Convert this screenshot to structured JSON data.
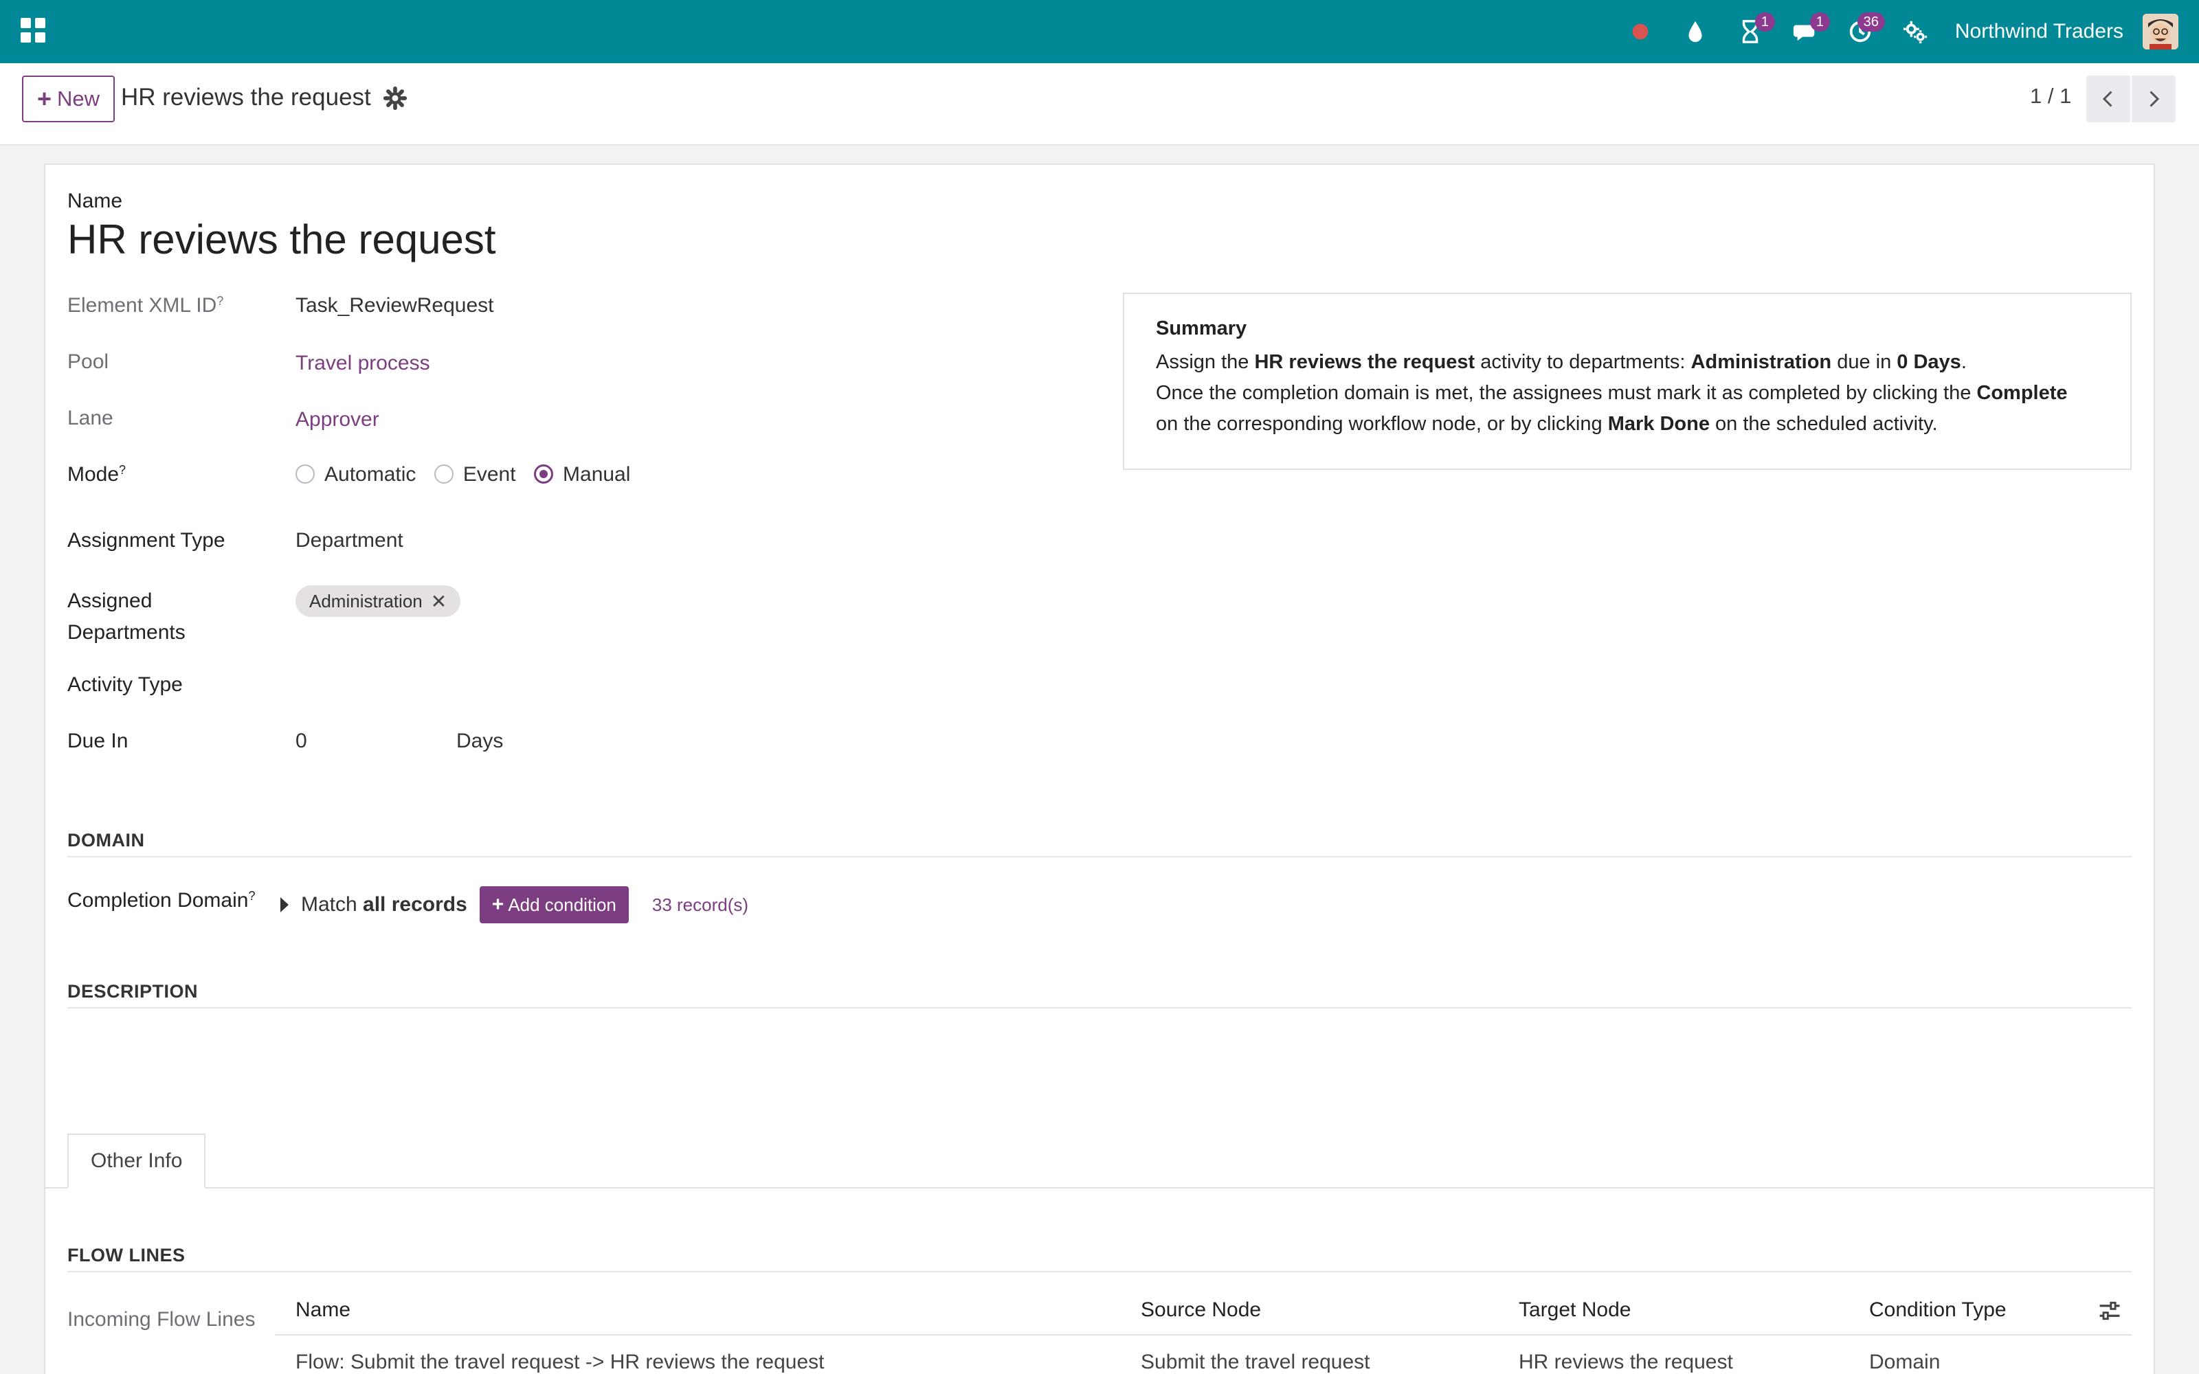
{
  "navbar": {
    "company": "Northwind Traders",
    "badges": {
      "activities": "1",
      "messages": "1",
      "clock": "36"
    },
    "icons": [
      "apps-icon",
      "record-dot-icon",
      "drop-icon",
      "hourglass-icon",
      "chat-icon",
      "clock-icon",
      "settings-icon"
    ]
  },
  "control": {
    "new_label": "New",
    "breadcrumb": "HR reviews the request",
    "pager": "1 / 1"
  },
  "form": {
    "name_label": "Name",
    "name_value": "HR reviews the request",
    "xml_id_label": "Element XML ID",
    "xml_id_value": "Task_ReviewRequest",
    "pool_label": "Pool",
    "pool_value": "Travel process",
    "lane_label": "Lane",
    "lane_value": "Approver",
    "mode_label": "Mode",
    "mode_options": [
      "Automatic",
      "Event",
      "Manual"
    ],
    "mode_selected": "Manual",
    "assign_type_label": "Assignment Type",
    "assign_type_value": "Department",
    "assigned_depts_label_1": "Assigned",
    "assigned_depts_label_2": "Departments",
    "assigned_dept_tag": "Administration",
    "activity_type_label": "Activity Type",
    "due_in_label": "Due In",
    "due_in_value": "0",
    "due_in_unit": "Days",
    "help_mark": "?"
  },
  "summary": {
    "title": "Summary",
    "l1_a": "Assign the ",
    "l1_b": "HR reviews the request",
    "l1_c": " activity to departments: ",
    "l1_d": "Administration",
    "l1_e": " due in ",
    "l1_f": "0 Days",
    "l1_g": ".",
    "l2_a": "Once the completion domain is met, the assignees must mark it as completed by clicking the ",
    "l2_b": "Complete",
    "l3_a": "on the corresponding workflow node, or by clicking ",
    "l3_b": "Mark Done",
    "l3_c": " on the scheduled activity."
  },
  "domain": {
    "section": "DOMAIN",
    "label": "Completion Domain",
    "match_a": "Match ",
    "match_b": "all records",
    "add_condition": "Add condition",
    "record_count": "33 record(s)"
  },
  "description": {
    "section": "DESCRIPTION"
  },
  "tabs": {
    "other_info": "Other Info"
  },
  "flow_lines": {
    "section": "FLOW LINES",
    "incoming_label": "Incoming Flow Lines",
    "columns": [
      "Name",
      "Source Node",
      "Target Node",
      "Condition Type"
    ],
    "rows": [
      [
        "Flow: Submit the travel request -> HR reviews the request",
        "Submit the travel request",
        "HR reviews the request",
        "Domain"
      ]
    ]
  }
}
